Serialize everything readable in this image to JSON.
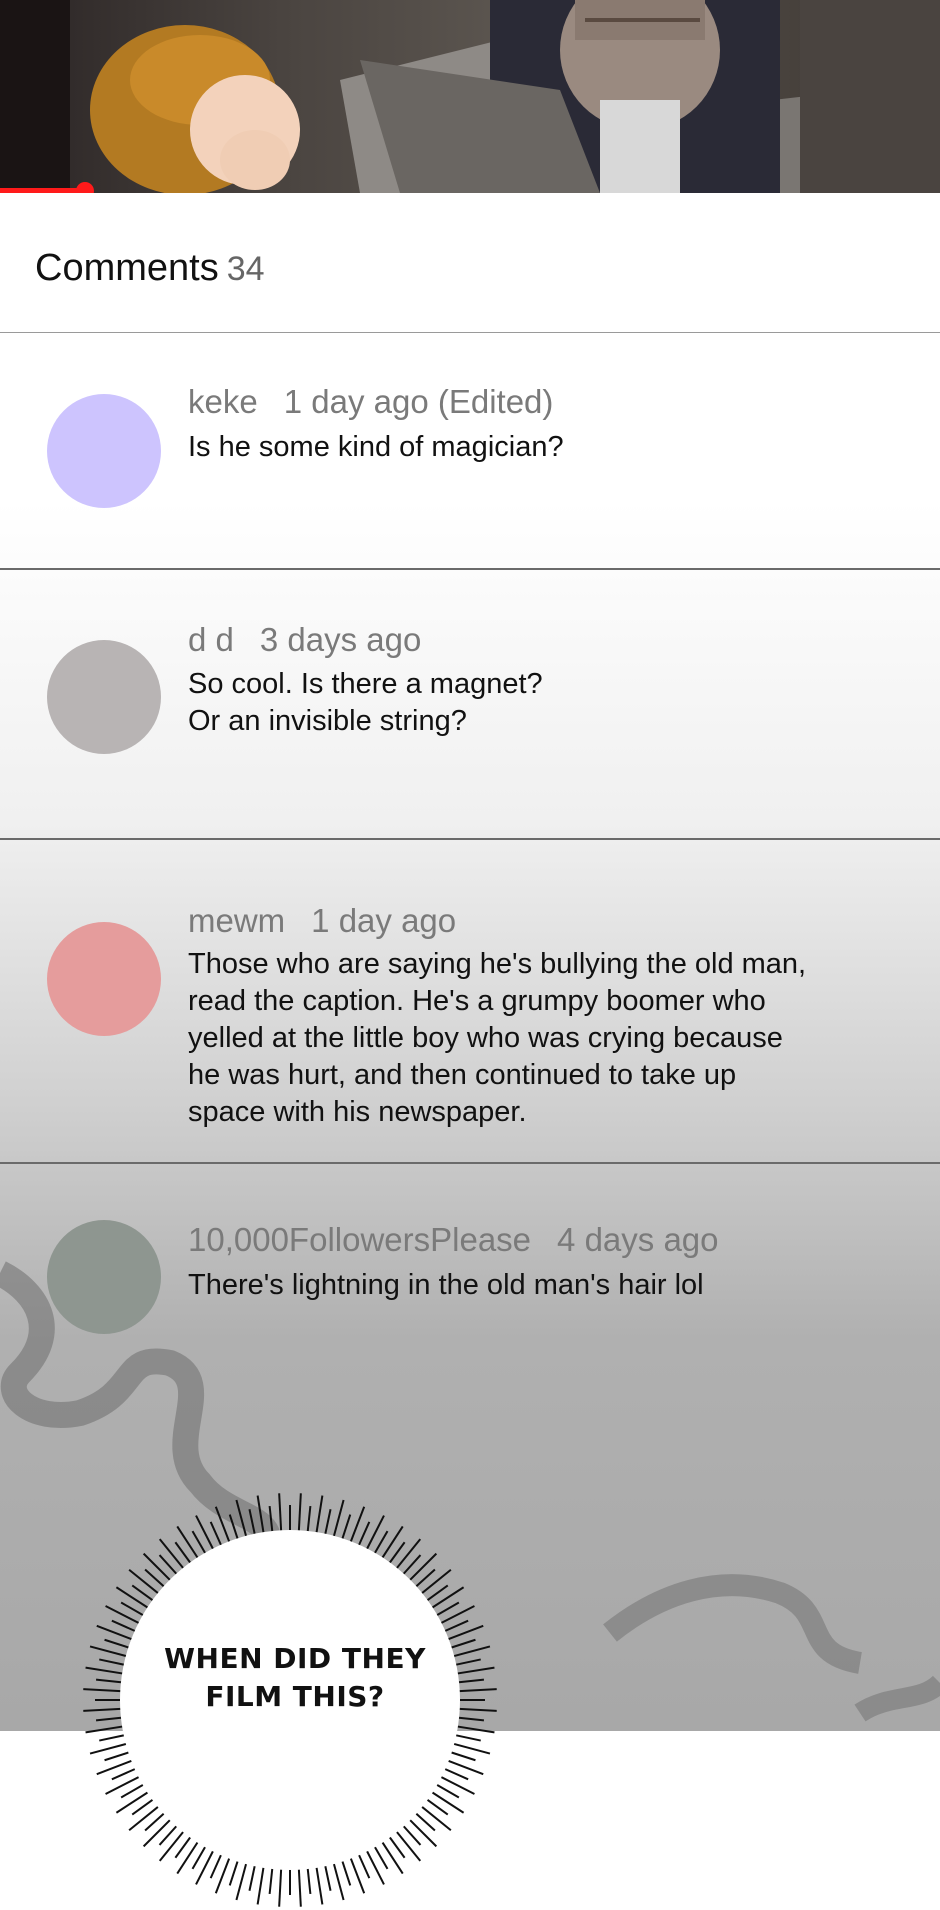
{
  "header": {
    "title": "Comments",
    "count": "34"
  },
  "comments": [
    {
      "user": "keke",
      "time": "1 day ago (Edited)",
      "lines": [
        "Is he some kind of magician?"
      ],
      "avatar_color": "#cdc4fe"
    },
    {
      "user": "d d",
      "time": "3 days ago",
      "lines": [
        "So cool. Is there a magnet?",
        "Or an invisible string?"
      ],
      "avatar_color": "#b8b4b4"
    },
    {
      "user": "mewm",
      "time": "1 day ago",
      "lines": [
        "Those who are saying he's bullying the old man,",
        "read the caption. He's a grumpy boomer who",
        "yelled at the little boy who was crying because",
        "he was hurt, and then continued to take up",
        "space with his newspaper."
      ],
      "avatar_color": "#e59c9c"
    },
    {
      "user": "10,000FollowersPlease",
      "time": "4 days ago",
      "lines": [
        "There's lightning in the old man's hair lol"
      ],
      "avatar_color": "#8e9690"
    }
  ],
  "video": {
    "progress_fraction": 0.09,
    "progress_color": "#ff1a1a"
  },
  "panel": {
    "bubble_text_line1": "WHEN DID THEY",
    "bubble_text_line2": "FILM THIS?"
  }
}
